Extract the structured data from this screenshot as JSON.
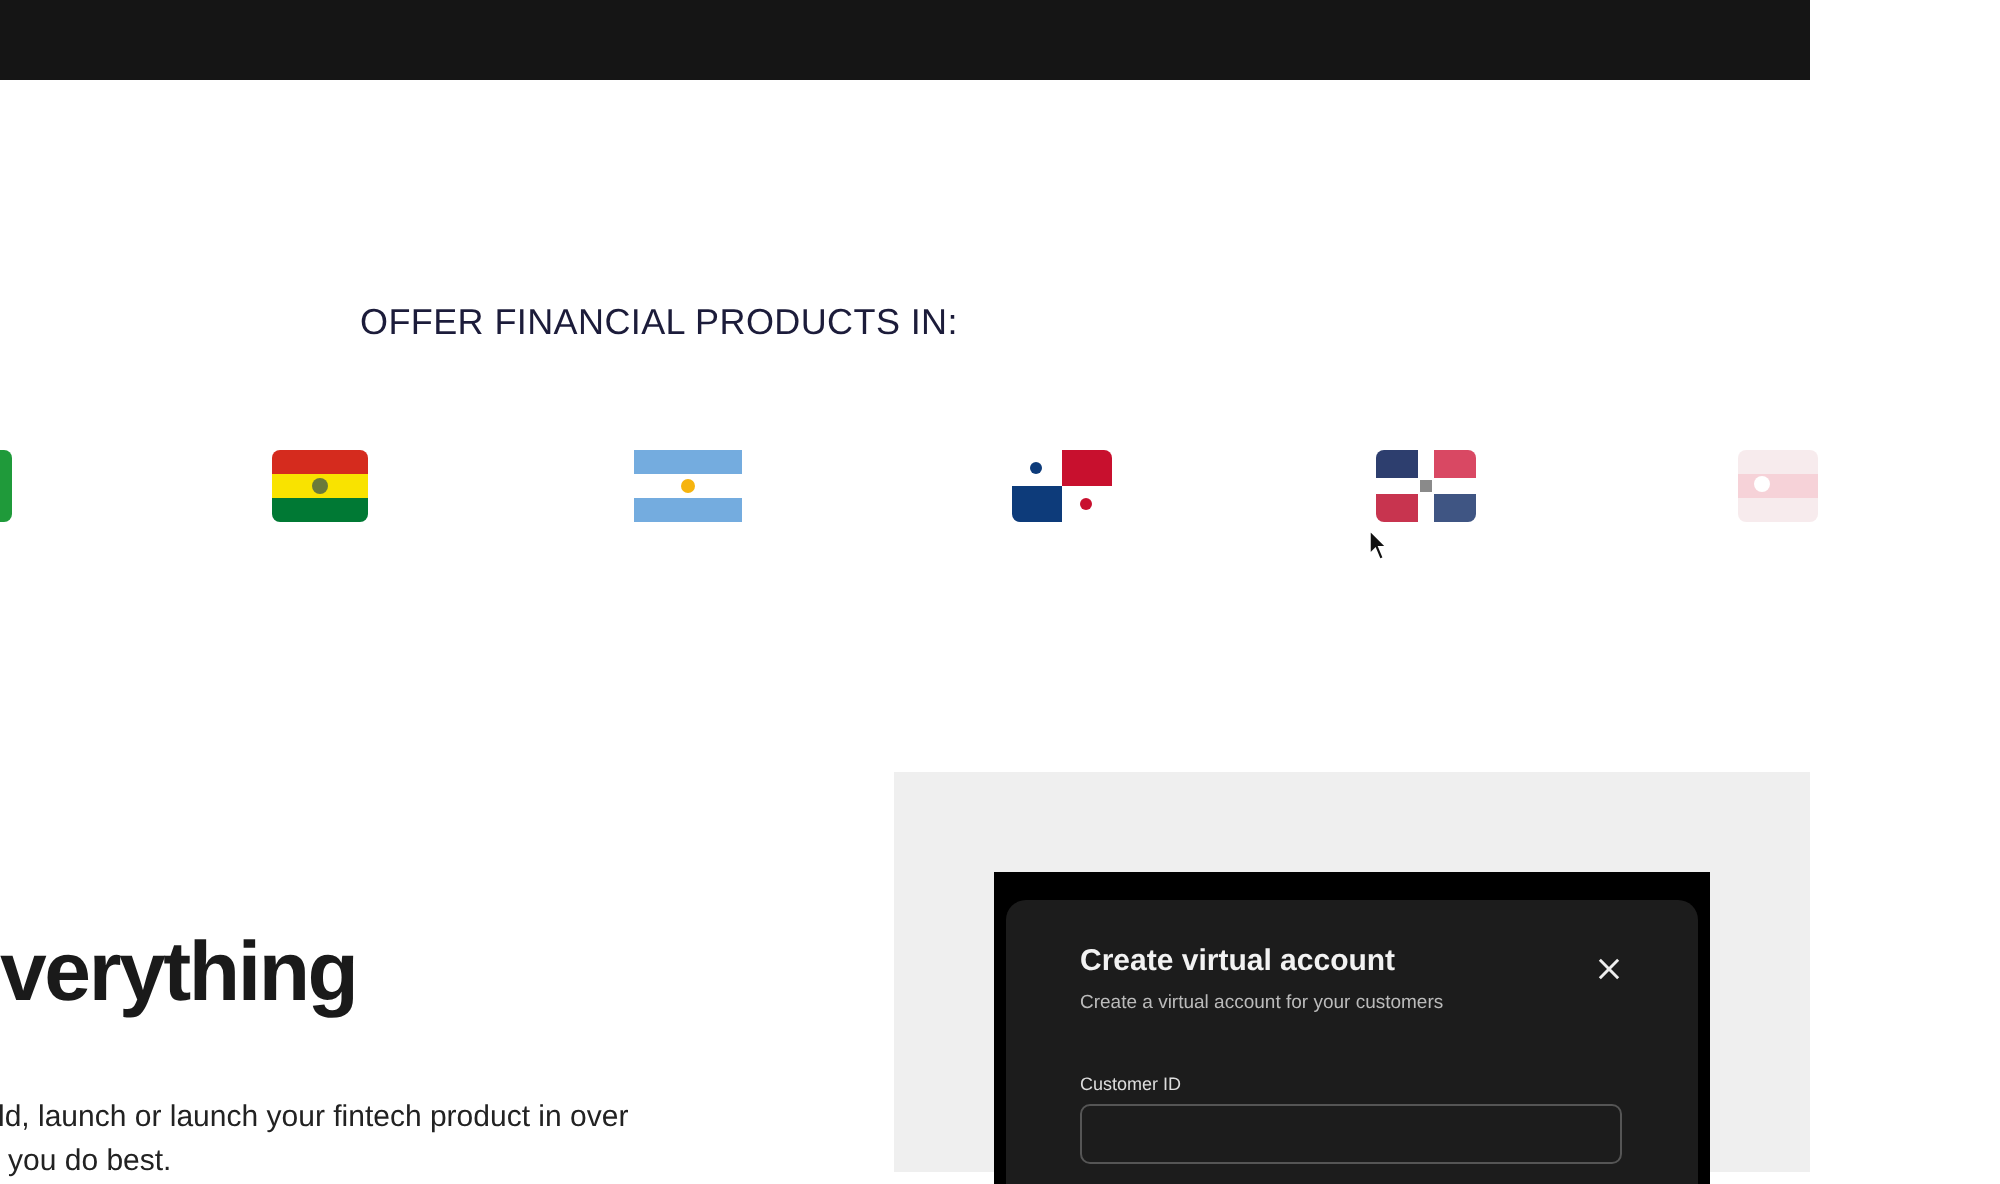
{
  "section_heading": "OFFER FINANCIAL PRODUCTS IN:",
  "hero": {
    "heading": "verything",
    "lines": [
      "ld, launch or launch your fintech product in over",
      "you do best."
    ]
  },
  "modal": {
    "title": "Create virtual account",
    "subtitle": "Create a virtual account for your customers",
    "field": {
      "label": "Customer ID"
    }
  }
}
